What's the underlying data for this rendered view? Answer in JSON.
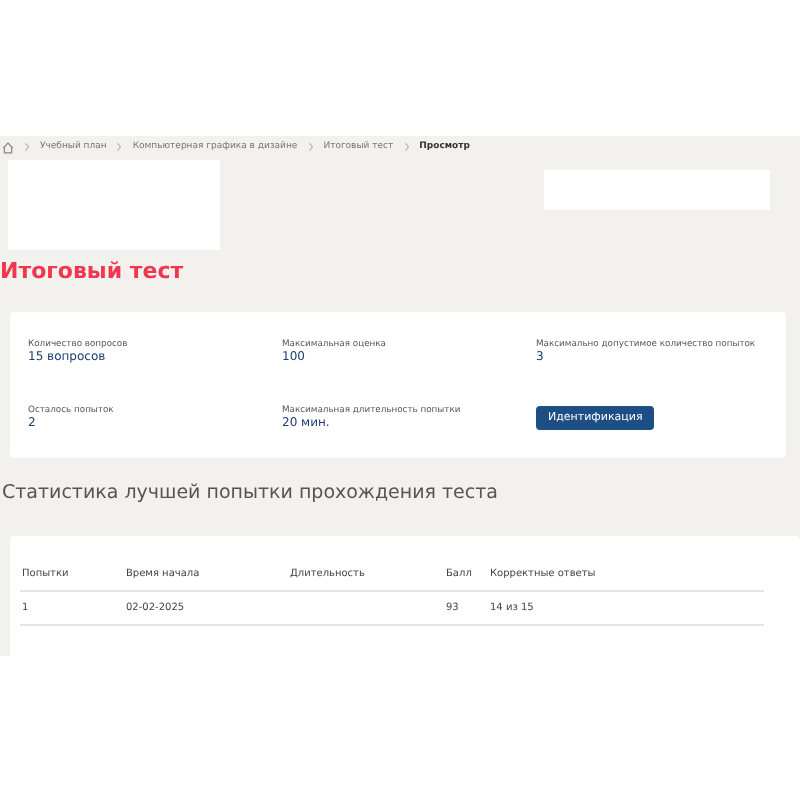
{
  "breadcrumbs": [
    {
      "label": "Учебный план"
    },
    {
      "label": "Компьютерная графика в дизайне"
    },
    {
      "label": "Итоговый тест"
    },
    {
      "label": "Просмотр",
      "current": true
    }
  ],
  "title": "Итоговый тест",
  "info": [
    {
      "label": "Количество вопросов",
      "value": "15 вопросов"
    },
    {
      "label": "Максимальная оценка",
      "value": "100"
    },
    {
      "label": "Максимально допустимое количество попыток",
      "value": "3"
    },
    {
      "label": "Осталось попыток",
      "value": "2"
    },
    {
      "label": "Максимальная длительность попытки",
      "value": "20 мин."
    }
  ],
  "identify_button": "Идентификация",
  "stats_title": "Статистика лучшей попытки прохождения теста",
  "table": {
    "columns": [
      "Попытки",
      "Время начала",
      "Длительность",
      "Балл",
      "Корректные ответы"
    ],
    "rows": [
      [
        "1",
        "02-02-2025",
        "",
        "93",
        "14 из 15"
      ]
    ]
  }
}
